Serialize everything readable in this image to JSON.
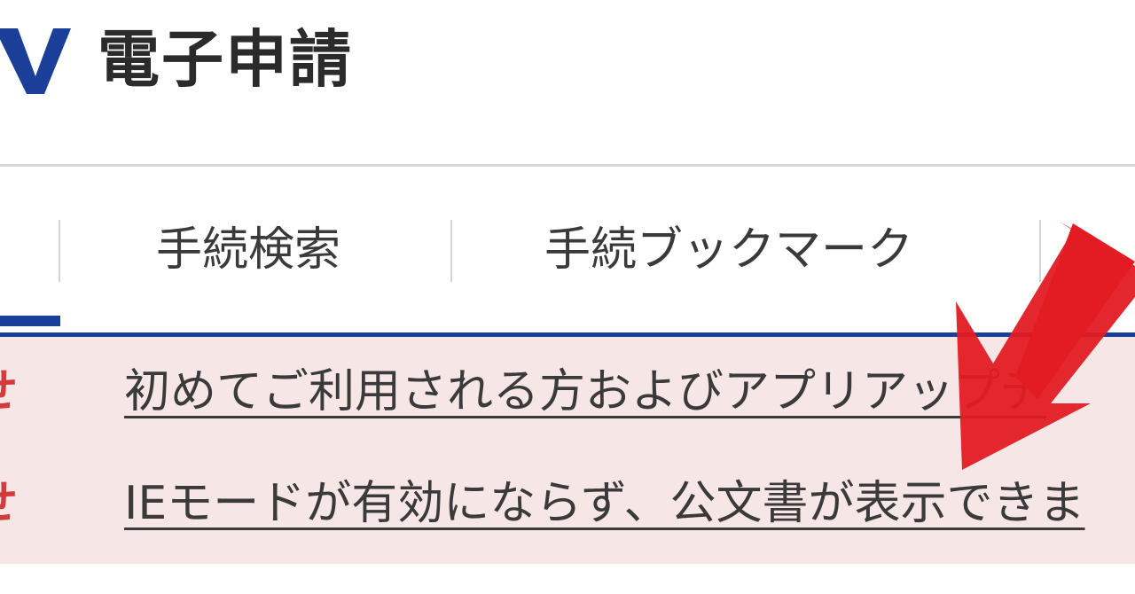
{
  "header": {
    "logo_icon": "brand-v-logo-icon",
    "title": "電子申請"
  },
  "nav": {
    "items": [
      {
        "label": "手続検索"
      },
      {
        "label": "手続ブックマーク"
      }
    ]
  },
  "notices": {
    "items": [
      {
        "label": "せ",
        "text": "初めてご利用される方およびアプリアップデ"
      },
      {
        "label": "せ",
        "text": "IEモードが有効にならず、公文書が表示できま"
      }
    ]
  },
  "annotation": {
    "icon": "red-arrow-annotation-icon"
  },
  "colors": {
    "brand_blue": "#1b3f99",
    "notice_bg": "#f7e6e6",
    "notice_label": "#d23b3b",
    "annotation_red": "#e31b23"
  }
}
